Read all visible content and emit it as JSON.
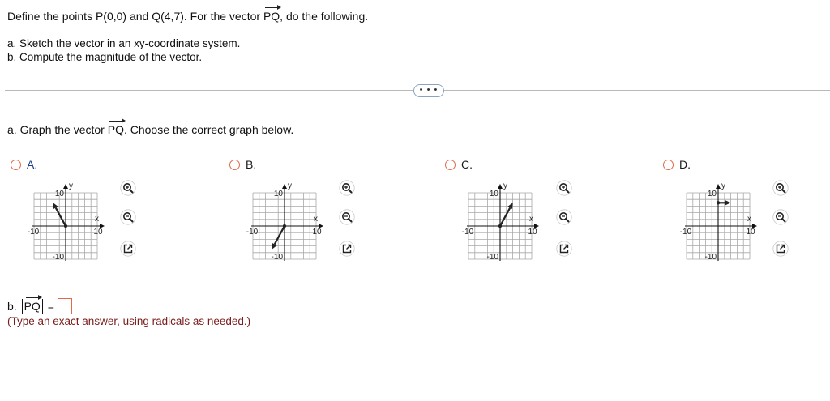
{
  "question": {
    "prefix": "Define the points P(0,0) and Q(4,7). For the vector ",
    "vector": "PQ",
    "suffix": ", do the following.",
    "part_a": "a. Sketch the vector in an xy-coordinate system.",
    "part_b": "b. Compute the magnitude of the vector."
  },
  "more_button": "• • •",
  "prompt": {
    "prefix": "a. Graph the vector ",
    "vector": "PQ",
    "suffix": ". Choose the correct graph below."
  },
  "options": [
    {
      "letter": "A.",
      "vector": {
        "from": [
          0,
          0
        ],
        "to": [
          -4,
          7
        ]
      }
    },
    {
      "letter": "B.",
      "vector": {
        "from": [
          0,
          0
        ],
        "to": [
          -4,
          -7
        ]
      }
    },
    {
      "letter": "C.",
      "vector": {
        "from": [
          0,
          0
        ],
        "to": [
          4,
          7
        ]
      }
    },
    {
      "letter": "D.",
      "vector": {
        "from": [
          0,
          7
        ],
        "to": [
          4,
          7
        ]
      }
    }
  ],
  "graph_labels": {
    "y": "y",
    "x": "x",
    "ymax": "10",
    "ymin": "-10",
    "xmin": "-10",
    "xmax": "10"
  },
  "graph_range": {
    "xmin": -10,
    "xmax": 10,
    "ymin": -10,
    "ymax": 10,
    "grid_step": 2
  },
  "tools": [
    "zoom-in-icon",
    "zoom-out-icon",
    "popout-icon"
  ],
  "answer": {
    "prefix": "b.",
    "vector": "PQ",
    "equals": "="
  },
  "hint": "(Type an exact answer, using radicals as needed.)",
  "colors": {
    "radio": "#e06b4c",
    "hint": "#7b1a1a",
    "vector": "#222222",
    "grid": "#a8a8a8"
  }
}
